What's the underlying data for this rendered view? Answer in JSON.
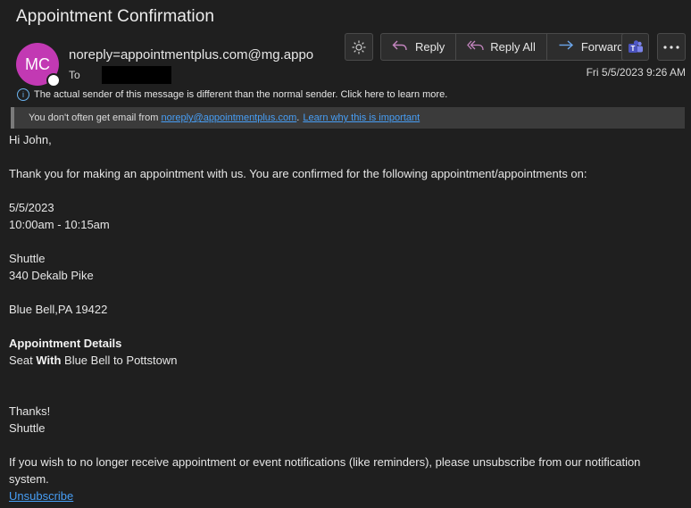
{
  "email": {
    "subject": "Appointment Confirmation",
    "avatar_initials": "MC",
    "sender": "noreply=appointmentplus.com@mg.appo",
    "to_label": "To",
    "date": "Fri 5/5/2023 9:26 AM",
    "info_text": "The actual sender of this message is different than the normal sender. Click here to learn more.",
    "warn_prefix": "You don't often get email from ",
    "warn_link": "noreply@appointmentplus.com",
    "warn_dot": ".",
    "warn_learn": "Learn why this is important"
  },
  "toolbar": {
    "reply": "Reply",
    "reply_all": "Reply All",
    "forward": "Forward"
  },
  "body": {
    "greeting": "Hi John,",
    "intro": "Thank you for making an appointment with us. You are confirmed for the following appointment/appointments on:",
    "date": "5/5/2023",
    "time": "10:00am - 10:15am",
    "location_name": "Shuttle",
    "address1": "340 Dekalb Pike",
    "address2": "Blue Bell,PA 19422",
    "details_heading": "Appointment Details",
    "details_prefix": "Seat ",
    "details_bold": "With",
    "details_suffix": " Blue Bell to Pottstown",
    "thanks": "Thanks!",
    "signoff": "Shuttle",
    "unsubscribe_text": "If you wish to no longer receive appointment or event notifications (like reminders), please unsubscribe from our notification system.",
    "unsubscribe_link": "Unsubscribe"
  },
  "colors": {
    "avatar": "#c239b3",
    "link": "#479ef5",
    "background": "#1f1f1f"
  },
  "icons": [
    "sun-icon",
    "reply-icon",
    "reply-all-icon",
    "forward-icon",
    "teams-icon",
    "more-icon",
    "info-icon"
  ]
}
